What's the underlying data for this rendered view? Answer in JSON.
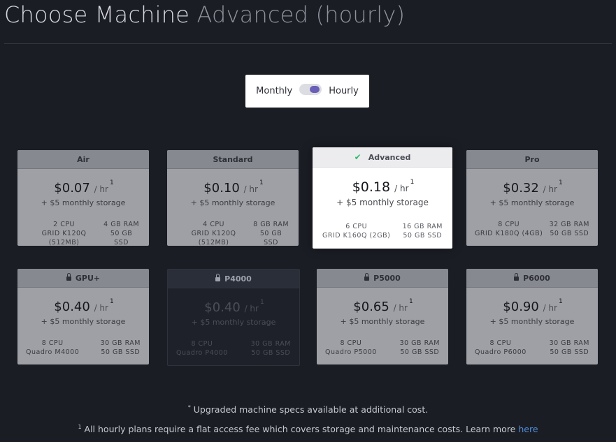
{
  "header": {
    "title": "Choose Machine",
    "subtitle": "Advanced (hourly)"
  },
  "billing_toggle": {
    "left_label": "Monthly",
    "right_label": "Hourly",
    "selected": "Hourly"
  },
  "plans": [
    {
      "name": "Air",
      "price": "$0.07",
      "unit": "/ hr",
      "note": "1",
      "storage": "+ $5 monthly storage",
      "cpu": "2 CPU",
      "gpu": "GRID K120Q (512MB)",
      "ram": "4 GB RAM",
      "ssd": "50 GB SSD"
    },
    {
      "name": "Standard",
      "price": "$0.10",
      "unit": "/ hr",
      "note": "1",
      "storage": "+ $5 monthly storage",
      "cpu": "4 CPU",
      "gpu": "GRID K120Q (512MB)",
      "ram": "8 GB RAM",
      "ssd": "50 GB SSD"
    },
    {
      "name": "Advanced",
      "price": "$0.18",
      "unit": "/ hr",
      "note": "1",
      "storage": "+ $5 monthly storage",
      "cpu": "6 CPU",
      "gpu": "GRID K160Q (2GB)",
      "ram": "16 GB RAM",
      "ssd": "50 GB SSD",
      "selected": true
    },
    {
      "name": "Pro",
      "price": "$0.32",
      "unit": "/ hr",
      "note": "1",
      "storage": "+ $5 monthly storage",
      "cpu": "8 CPU",
      "gpu": "GRID K180Q (4GB)",
      "ram": "32 GB RAM",
      "ssd": "50 GB SSD"
    },
    {
      "name": "GPU+",
      "price": "$0.40",
      "unit": "/ hr",
      "note": "1",
      "storage": "+ $5 monthly storage",
      "cpu": "8 CPU",
      "gpu": "Quadro M4000",
      "ram": "30 GB RAM",
      "ssd": "50 GB SSD",
      "locked": true
    },
    {
      "name": "P4000",
      "price": "$0.40",
      "unit": "/ hr",
      "note": "1",
      "storage": "+ $5 monthly storage",
      "cpu": "8 CPU",
      "gpu": "Quadro P4000",
      "ram": "30 GB RAM",
      "ssd": "50 GB SSD",
      "locked": true,
      "unavailable": true
    },
    {
      "name": "P5000",
      "price": "$0.65",
      "unit": "/ hr",
      "note": "1",
      "storage": "+ $5 monthly storage",
      "cpu": "8 CPU",
      "gpu": "Quadro P5000",
      "ram": "30 GB RAM",
      "ssd": "50 GB SSD",
      "locked": true
    },
    {
      "name": "P6000",
      "price": "$0.90",
      "unit": "/ hr",
      "note": "1",
      "storage": "+ $5 monthly storage",
      "cpu": "8 CPU",
      "gpu": "Quadro P6000",
      "ram": "30 GB RAM",
      "ssd": "50 GB SSD",
      "locked": true
    }
  ],
  "footnotes": {
    "mark1": "*",
    "note1": "Upgraded machine specs available at additional cost.",
    "mark2": "1",
    "note2": "All hourly plans require a flat access fee which covers storage and maintenance costs. Learn more",
    "link": "here"
  },
  "icons": {
    "check": "check-icon",
    "lock": "lock-icon"
  },
  "colors": {
    "accent": "#6a5fb6",
    "check": "#2ebd6b",
    "link": "#4f8fd8",
    "background": "#1b1d25"
  }
}
